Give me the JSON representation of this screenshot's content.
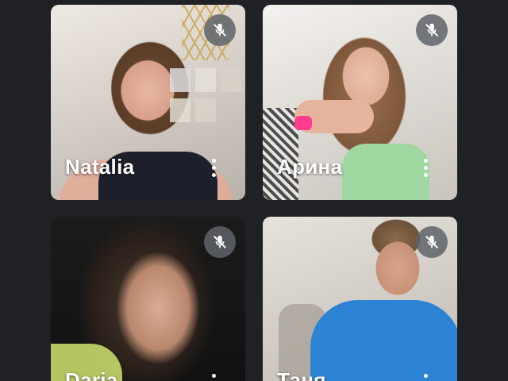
{
  "participants": [
    {
      "name": "Natalia",
      "mic": "mic-off-icon",
      "menu": "more-vert-icon"
    },
    {
      "name": "Арина",
      "mic": "mic-off-icon",
      "menu": "more-vert-icon"
    },
    {
      "name": "Daria",
      "mic": "mic-off-icon",
      "menu": "more-vert-icon"
    },
    {
      "name": "Таня",
      "mic": "mic-off-icon",
      "menu": "more-vert-icon"
    }
  ],
  "colors": {
    "background": "#202124",
    "overlay_button": "#5f6368",
    "name_text": "#ffffff"
  }
}
